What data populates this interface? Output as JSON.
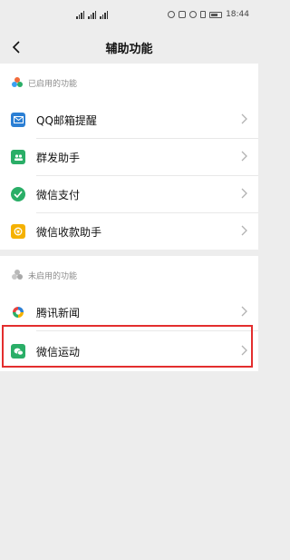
{
  "status_bar": {
    "time": "18:44",
    "battery": "75"
  },
  "header": {
    "title": "辅助功能"
  },
  "enabled_section": {
    "header": "已启用的功能",
    "items": [
      {
        "label": "QQ邮箱提醒",
        "icon": "mail-icon",
        "color": "#2b7fd4"
      },
      {
        "label": "群发助手",
        "icon": "group-send-icon",
        "color": "#2aae67"
      },
      {
        "label": "微信支付",
        "icon": "wechat-pay-icon",
        "color": "#2aae67"
      },
      {
        "label": "微信收款助手",
        "icon": "receipt-icon",
        "color": "#f5b100"
      }
    ]
  },
  "disabled_section": {
    "header": "未启用的功能",
    "items": [
      {
        "label": "腾讯新闻",
        "icon": "tencent-news-icon"
      },
      {
        "label": "微信运动",
        "icon": "wechat-sport-icon",
        "color": "#2aae67"
      }
    ]
  },
  "colors": {
    "background": "#ededed",
    "highlight": "#e32e2e"
  }
}
